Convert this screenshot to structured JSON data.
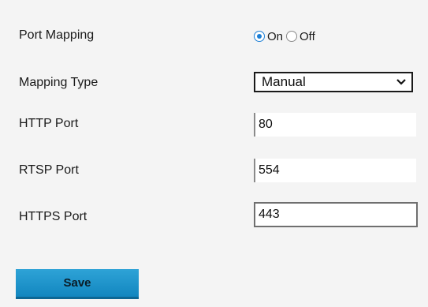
{
  "port_mapping": {
    "label": "Port Mapping",
    "options": [
      {
        "label": "On",
        "checked": true
      },
      {
        "label": "Off",
        "checked": false
      }
    ]
  },
  "mapping_type": {
    "label": "Mapping Type",
    "value": "Manual"
  },
  "http_port": {
    "label": "HTTP Port",
    "value": "80"
  },
  "rtsp_port": {
    "label": "RTSP Port",
    "value": "554"
  },
  "https_port": {
    "label": "HTTPS Port",
    "value": "443"
  },
  "save_label": "Save",
  "colors": {
    "accent": "#1c7fd6",
    "button": "#1a93cc",
    "background": "#f4f4f4"
  }
}
